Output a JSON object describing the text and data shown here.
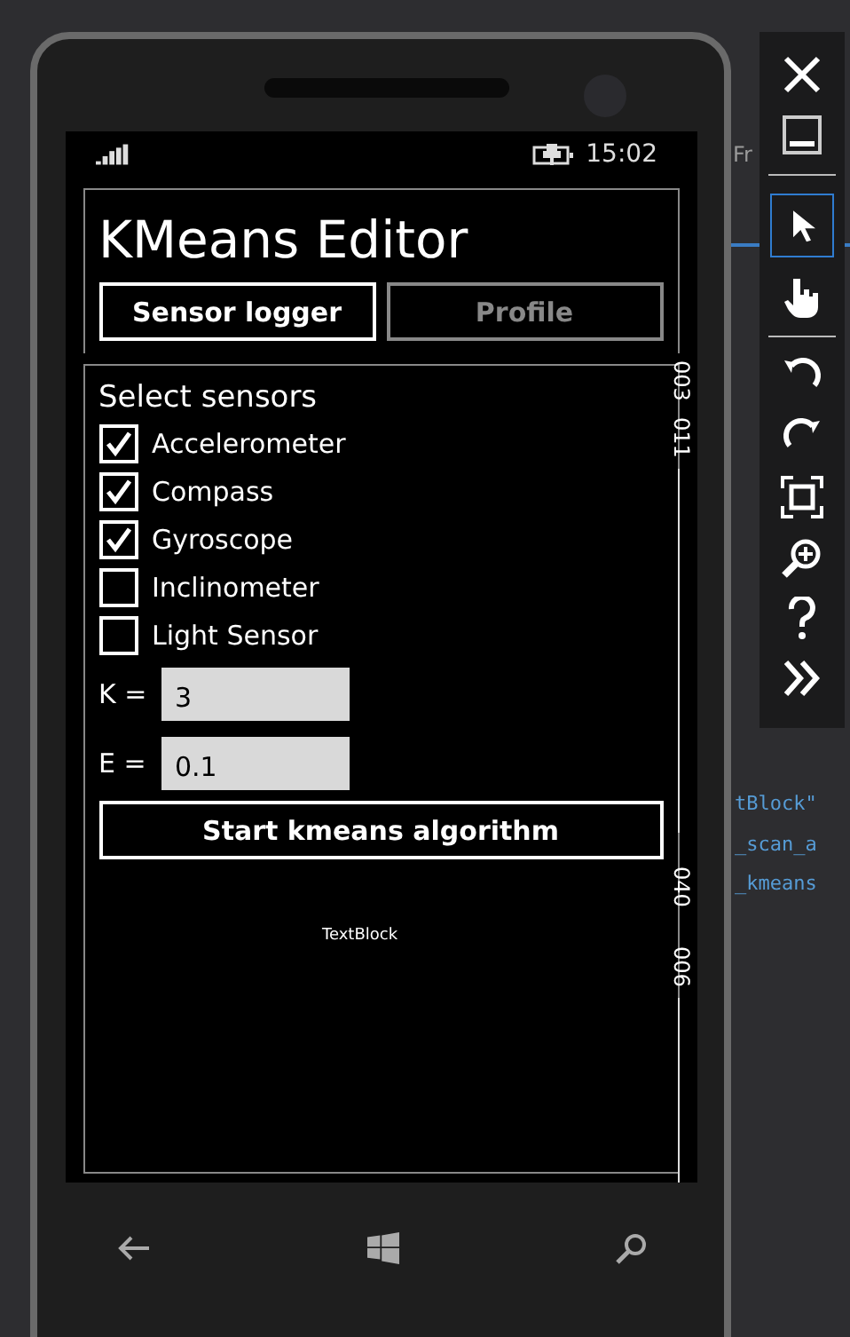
{
  "background_code": [
    {
      "text": "Fr",
      "kind": "label"
    },
    {
      "text": "tBlock\"",
      "kind": "code"
    },
    {
      "text": "_scan_a",
      "kind": "code"
    },
    {
      "text": "_kmeans",
      "kind": "code"
    }
  ],
  "status_bar": {
    "time": "15:02"
  },
  "title": "KMeans Editor",
  "tabs": [
    {
      "label": "Sensor logger",
      "selected": true
    },
    {
      "label": "Profile",
      "selected": false
    }
  ],
  "section_title": "Select sensors",
  "sensors": [
    {
      "label": "Accelerometer",
      "checked": true
    },
    {
      "label": "Compass",
      "checked": true
    },
    {
      "label": "Gyroscope",
      "checked": true
    },
    {
      "label": "Inclinometer",
      "checked": false
    },
    {
      "label": "Light Sensor",
      "checked": false
    }
  ],
  "fields": [
    {
      "label": "K =",
      "value": "3"
    },
    {
      "label": "E =",
      "value": "0.1"
    }
  ],
  "button": "Start kmeans algorithm",
  "output_text": "TextBlock",
  "ruler_labels": [
    "003",
    "011",
    "040",
    "006"
  ]
}
